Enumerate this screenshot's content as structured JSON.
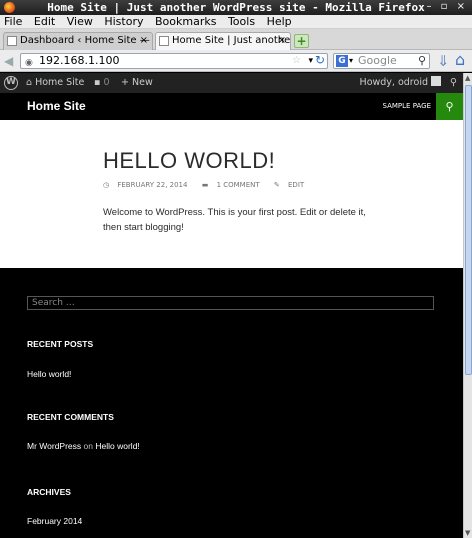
{
  "window": {
    "title": "Home Site | Just another WordPress site - Mozilla Firefox",
    "controls": "– ▫ ×"
  },
  "menu": [
    "File",
    "Edit",
    "View",
    "History",
    "Bookmarks",
    "Tools",
    "Help"
  ],
  "tabs": [
    {
      "label": "Dashboard ‹ Home Site — W...",
      "close": "×"
    },
    {
      "label": "Home Site | Just another Wor...",
      "close": "×"
    }
  ],
  "newtab": "+",
  "nav": {
    "back": "◀",
    "url": "192.168.1.100",
    "search_placeholder": "Google",
    "search_engine_letter": "G"
  },
  "adminbar": {
    "site_name": "Home Site",
    "comments_count": "0",
    "new_label": "New",
    "howdy": "Howdy, odroid"
  },
  "site": {
    "title": "Home Site",
    "nav_item": "SAMPLE PAGE"
  },
  "post": {
    "title": "HELLO WORLD!",
    "date": "FEBRUARY 22, 2014",
    "comments": "1 COMMENT",
    "edit": "EDIT",
    "body": "Welcome to WordPress. This is your first post. Edit or delete it, then start blogging!"
  },
  "footer": {
    "search_placeholder": "Search …",
    "recent_posts_title": "RECENT POSTS",
    "recent_post": "Hello world!",
    "recent_comments_title": "RECENT COMMENTS",
    "comment_author": "Mr WordPress",
    "comment_on": "on",
    "comment_post": "Hello world!",
    "archives_title": "ARCHIVES",
    "archive_item": "February 2014"
  }
}
